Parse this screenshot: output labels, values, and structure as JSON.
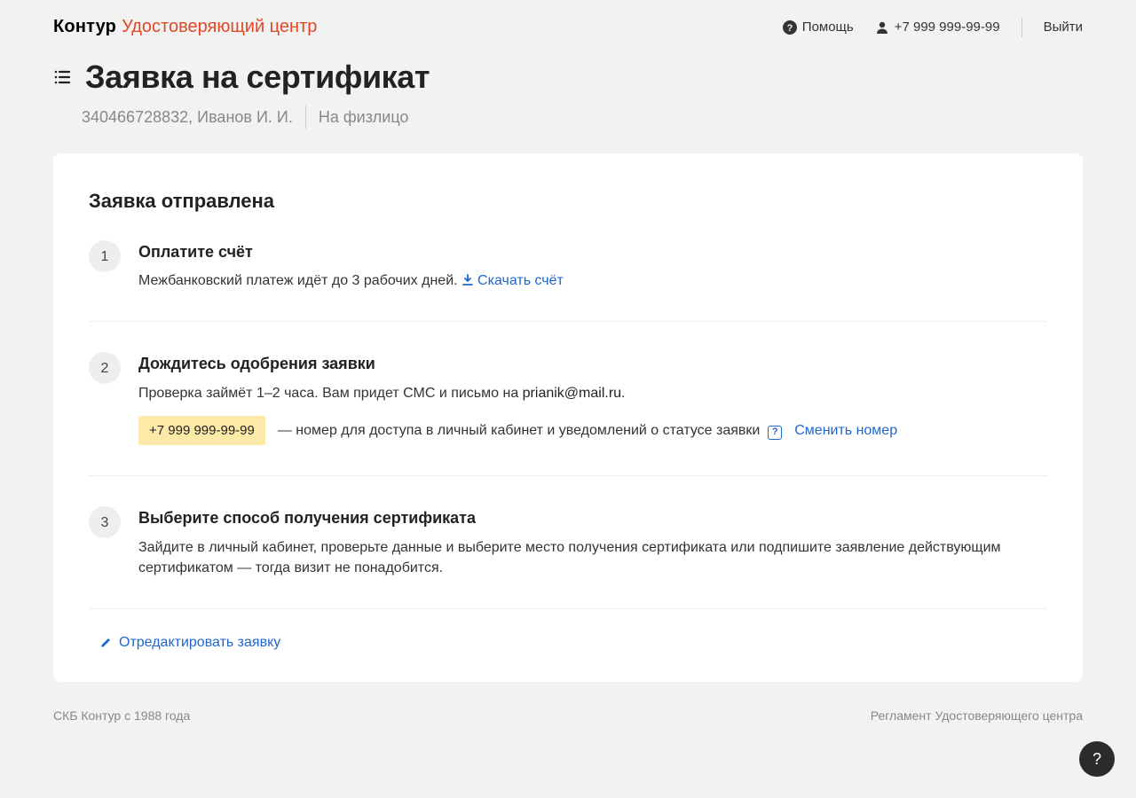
{
  "header": {
    "logo_main": "Контур",
    "logo_sub": "Удостоверяющий центр",
    "help": "Помощь",
    "phone": "+7 999 999-99-99",
    "logout": "Выйти"
  },
  "page": {
    "title": "Заявка на сертификат",
    "sub_id": "340466728832, Иванов И. И.",
    "sub_type": "На физлицо"
  },
  "card": {
    "heading": "Заявка отправлена",
    "steps": [
      {
        "num": "1",
        "title": "Оплатите счёт",
        "desc_plain": "Межбанковский платеж идёт до 3 рабочих дней.",
        "download": "Скачать счёт"
      },
      {
        "num": "2",
        "title": "Дождитесь одобрения заявки",
        "desc_prefix": "Проверка займёт 1–2 часа. Вам придет СМС и письмо на ",
        "email": "prianik@mail.ru",
        "desc_suffix": ".",
        "phone": "+7 999 999-99-99",
        "phone_text": " — номер для доступа в личный кабинет и уведомлений о статусе заявки",
        "help_glyph": "?",
        "change": "Сменить номер"
      },
      {
        "num": "3",
        "title": "Выберите способ получения сертификата",
        "desc_plain": "Зайдите в личный кабинет, проверьте данные и выберите место получения сертификата или подпишите заявление действующим сертификатом — тогда визит не понадобится."
      }
    ],
    "edit": "Отредактировать заявку"
  },
  "footer": {
    "left": "СКБ Контур с 1988 года",
    "right": "Регламент Удостоверяющего центра"
  },
  "fab": "?"
}
